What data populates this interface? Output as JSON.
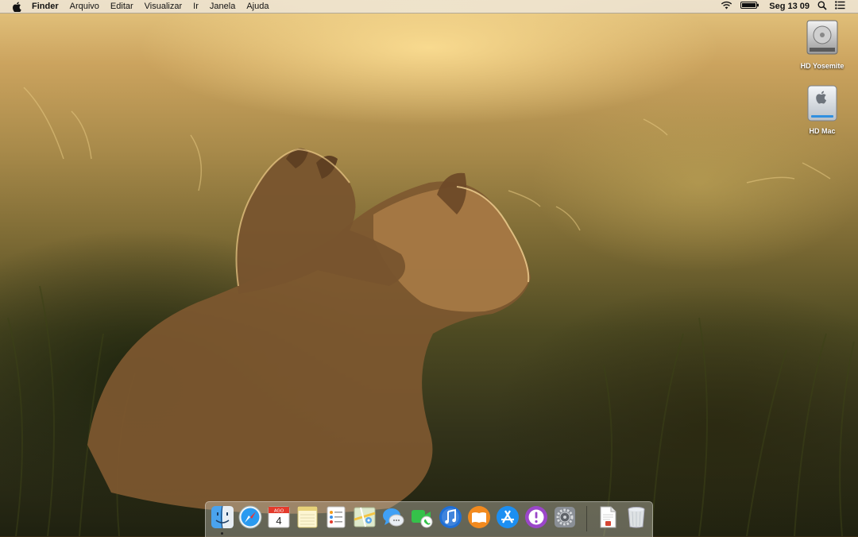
{
  "menubar": {
    "app_name": "Finder",
    "menus": [
      "Arquivo",
      "Editar",
      "Visualizar",
      "Ir",
      "Janela",
      "Ajuda"
    ],
    "clock": "Seg 13 09",
    "status_icons": [
      "apple-icon",
      "wifi-icon",
      "battery-icon",
      "spotlight-icon",
      "notification-center-icon"
    ]
  },
  "desktop": {
    "icons": [
      {
        "label": "HD Yosemite",
        "icon": "hard-drive-icon"
      },
      {
        "label": "HD Mac",
        "icon": "external-drive-icon"
      }
    ]
  },
  "dock": {
    "calendar": {
      "month": "AGO",
      "day": "4"
    },
    "items": [
      "Finder",
      "Safari",
      "Calendário",
      "Notas",
      "Lembretes",
      "Mapas",
      "Mensagens",
      "FaceTime",
      "iTunes",
      "iBooks",
      "App Store",
      "Feedback Assistant",
      "Preferências do Sistema",
      "Documento",
      "Lixo"
    ]
  }
}
